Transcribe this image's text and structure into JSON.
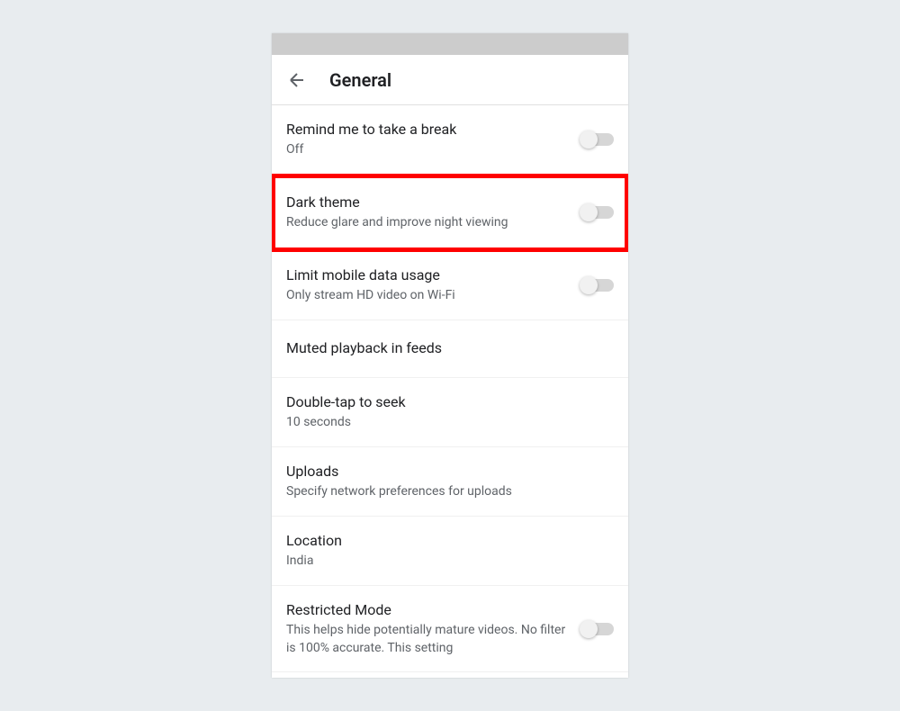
{
  "header": {
    "title": "General"
  },
  "settings": [
    {
      "title": "Remind me to take a break",
      "subtitle": "Off",
      "hasToggle": true,
      "highlighted": false
    },
    {
      "title": "Dark theme",
      "subtitle": "Reduce glare and improve night viewing",
      "hasToggle": true,
      "highlighted": true
    },
    {
      "title": "Limit mobile data usage",
      "subtitle": "Only stream HD video on Wi-Fi",
      "hasToggle": true,
      "highlighted": false
    },
    {
      "title": "Muted playback in feeds",
      "subtitle": "",
      "hasToggle": false,
      "highlighted": false
    },
    {
      "title": "Double-tap to seek",
      "subtitle": "10 seconds",
      "hasToggle": false,
      "highlighted": false
    },
    {
      "title": "Uploads",
      "subtitle": "Specify network preferences for uploads",
      "hasToggle": false,
      "highlighted": false
    },
    {
      "title": "Location",
      "subtitle": "India",
      "hasToggle": false,
      "highlighted": false
    },
    {
      "title": "Restricted Mode",
      "subtitle": "This helps hide potentially mature videos. No filter is 100% accurate. This setting",
      "hasToggle": true,
      "highlighted": false
    }
  ]
}
